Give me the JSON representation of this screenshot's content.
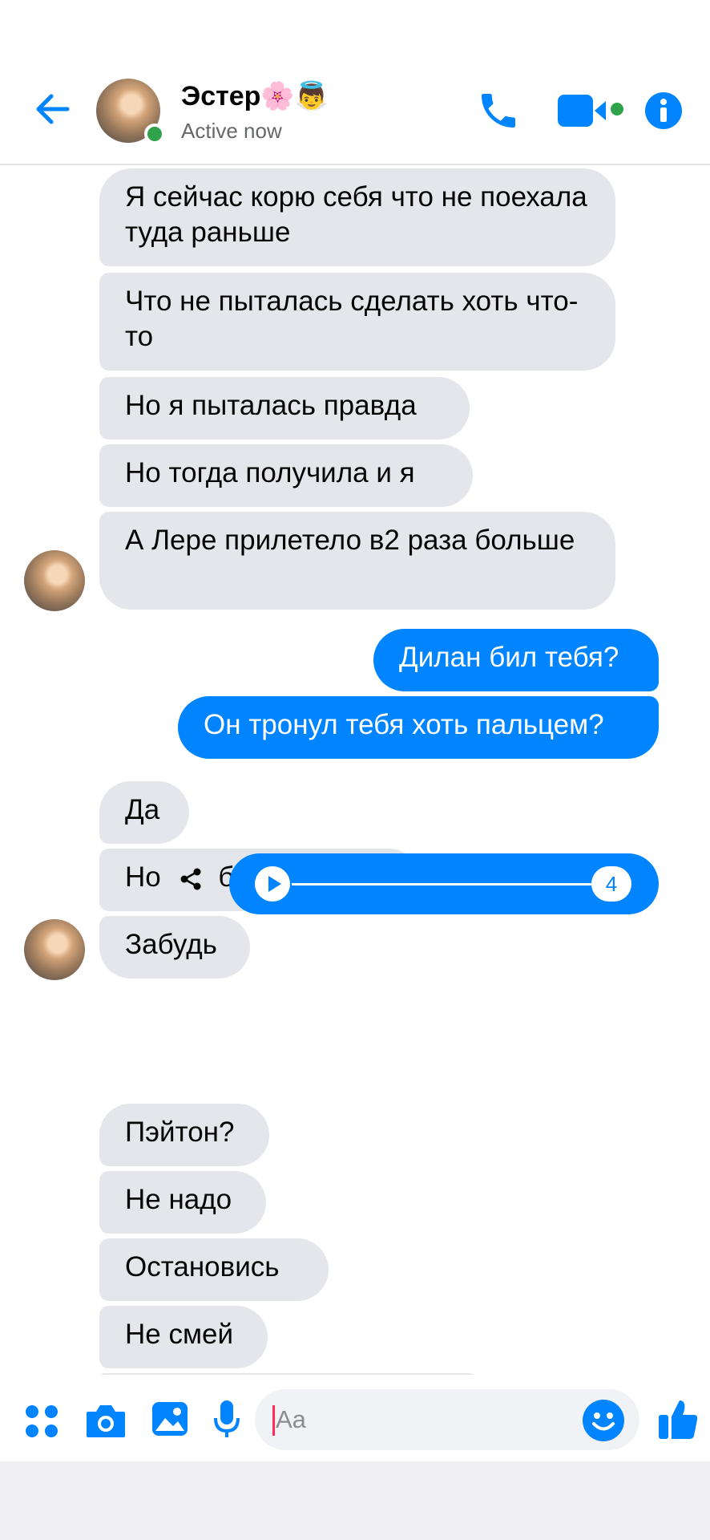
{
  "header": {
    "name": "Эстер🌸👼",
    "status": "Active now"
  },
  "colors": {
    "accent": "#0084ff",
    "incoming": "#e4e6eb",
    "online": "#31a24c"
  },
  "messages": [
    {
      "side": "in",
      "text": "Я сейчас корю себя что не поехала туда раньше"
    },
    {
      "side": "in",
      "text": "Что не пыталась сделать хоть что-то"
    },
    {
      "side": "in",
      "text": "Но я пыталась правда"
    },
    {
      "side": "in",
      "text": "Но тогда получила и я"
    },
    {
      "side": "in",
      "text": "А Лере прилетело в2 раза больше"
    },
    {
      "side": "out",
      "text": "Дилан бил тебя?"
    },
    {
      "side": "out",
      "text": "Он тронул тебя хоть пальцем?"
    },
    {
      "side": "in",
      "text": "Да"
    },
    {
      "side": "in",
      "text": "Но это было давно"
    },
    {
      "side": "in",
      "text": "Забудь"
    },
    {
      "side": "in",
      "text": "Пэйтон?"
    },
    {
      "side": "in",
      "text": "Не надо"
    },
    {
      "side": "in",
      "text": "Остановись"
    },
    {
      "side": "in",
      "text": "Не смей"
    }
  ],
  "voice_message": {
    "duration": "4",
    "progress": 0
  },
  "composer": {
    "placeholder": "Aa"
  },
  "icons": [
    "back-arrow-icon",
    "phone-icon",
    "video-icon",
    "info-icon",
    "share-icon",
    "play-icon",
    "menu-dots-icon",
    "camera-icon",
    "gallery-icon",
    "microphone-icon",
    "emoji-icon",
    "like-icon"
  ]
}
